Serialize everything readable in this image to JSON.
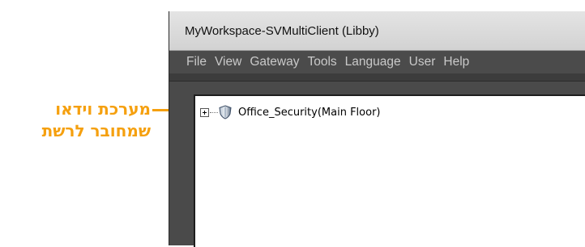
{
  "annotation": {
    "line1": "מערכת וידאו",
    "line2": "שמחובר לרשת",
    "color": "#f5a00f"
  },
  "window": {
    "title": "MyWorkspace-SVMultiClient (Libby)"
  },
  "menu": {
    "items": [
      {
        "label": "File"
      },
      {
        "label": "View"
      },
      {
        "label": "Gateway"
      },
      {
        "label": "Tools"
      },
      {
        "label": "Language"
      },
      {
        "label": "User"
      },
      {
        "label": "Help"
      }
    ]
  },
  "tree": {
    "nodes": [
      {
        "label": "Office_Security(Main Floor)",
        "expanded": false,
        "icon": "shield-icon"
      }
    ]
  }
}
